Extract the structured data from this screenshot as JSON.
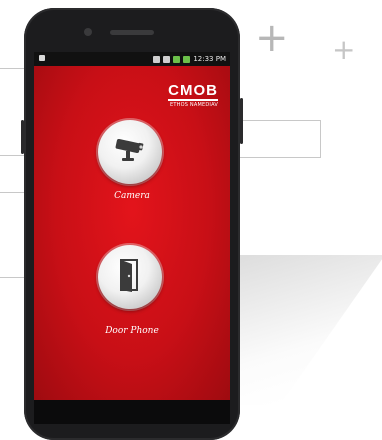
{
  "status_bar": {
    "left_icon": "app-notification",
    "time": "12:33 PM"
  },
  "app": {
    "logo_main": "CMOB",
    "logo_sub": "ETHOS NAMEDIAV"
  },
  "buttons": [
    {
      "label": "Camera",
      "icon": "cctv-camera-icon"
    },
    {
      "label": "Door Phone",
      "icon": "door-icon"
    }
  ],
  "decor": {
    "plus_big": "+",
    "plus_small": "+"
  },
  "colors": {
    "screen_red": "#d81219",
    "device": "#1c1c1e"
  }
}
